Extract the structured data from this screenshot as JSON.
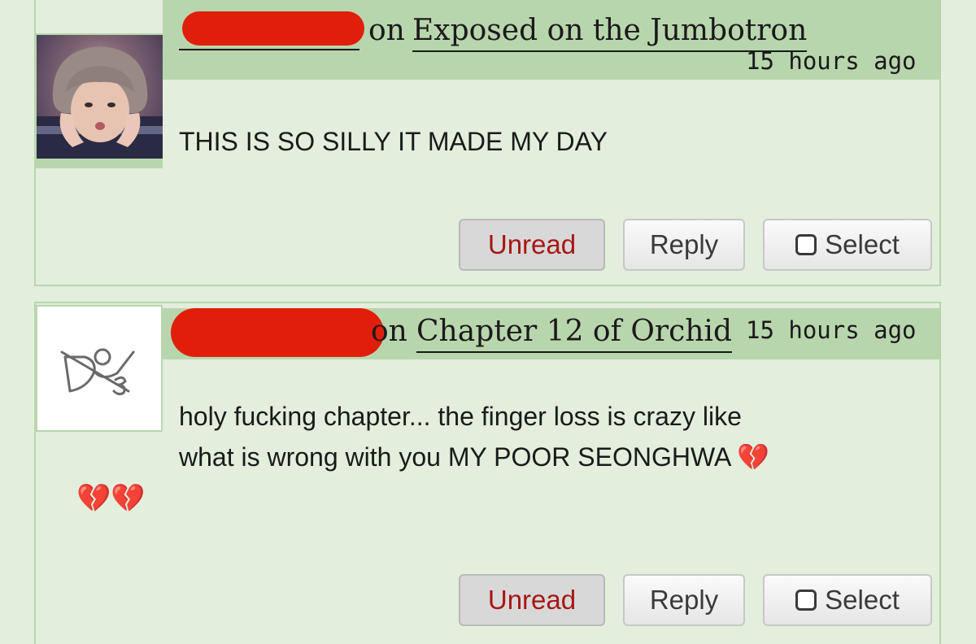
{
  "comments": [
    {
      "on_label": "on",
      "work_title": "Exposed on the Jumbotron",
      "timestamp": "15 hours ago",
      "body_lines": [
        "THIS IS SO SILLY IT MADE MY DAY"
      ],
      "buttons": {
        "unread": "Unread",
        "reply": "Reply",
        "select": "Select"
      },
      "avatar_icon": "user-photo-avatar"
    },
    {
      "on_label": "on",
      "work_title": "Chapter 12 of Orchid",
      "timestamp": "15 hours ago",
      "body_lines": [
        "holy fucking chapter... the finger loss is crazy like",
        "what is wrong with you MY POOR SEONGHWA"
      ],
      "body_emoji": "💔",
      "buttons": {
        "unread": "Unread",
        "reply": "Reply",
        "select": "Select"
      },
      "avatar_icon": "sketch-logo-avatar",
      "avatar_emoji": "💔💔"
    }
  ],
  "colors": {
    "background": "#e3eedd",
    "header": "#b8d6ad",
    "redaction": "#e11e09",
    "unread_text": "#a81616"
  }
}
